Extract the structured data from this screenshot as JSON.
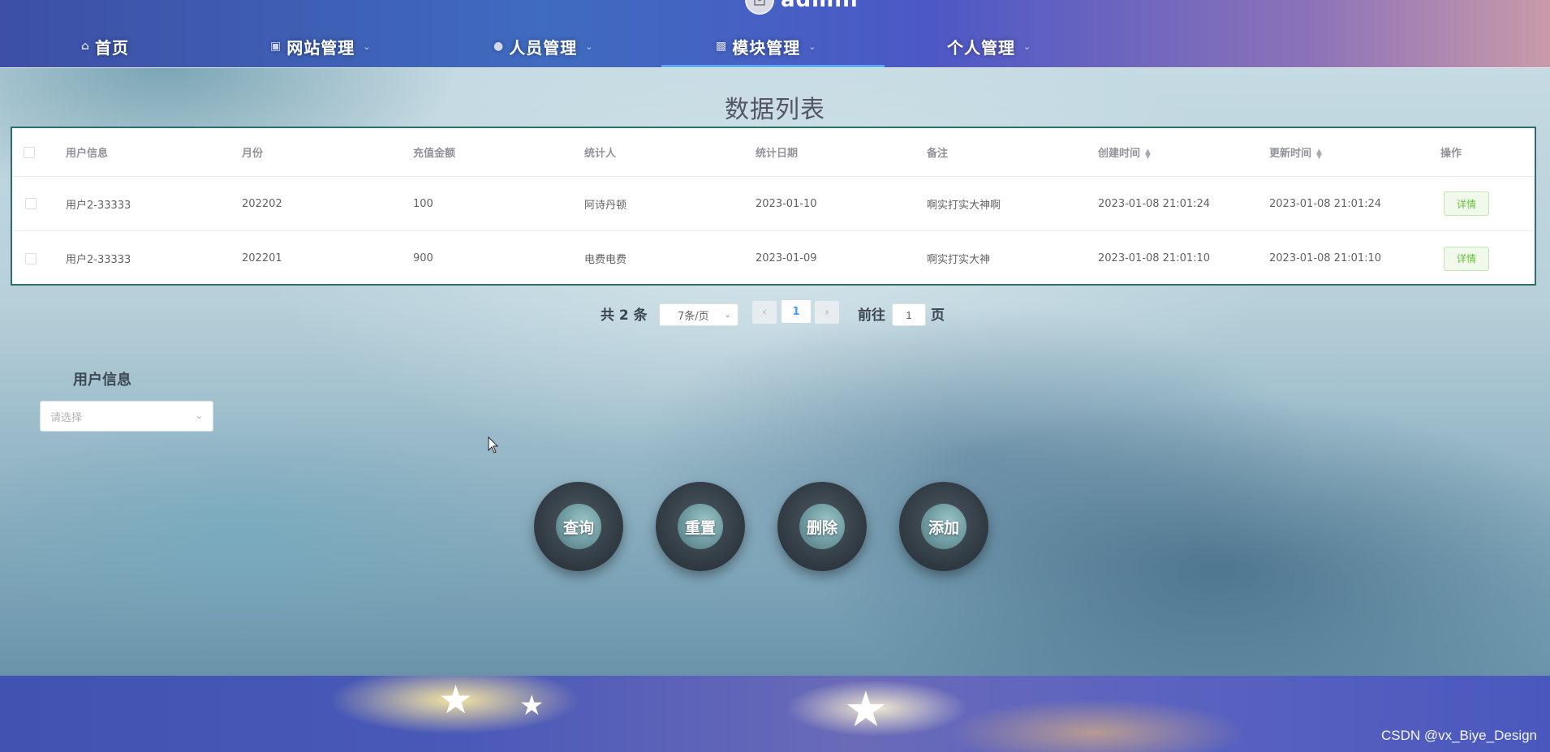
{
  "nav": {
    "admin_name": "admin",
    "items": [
      {
        "label": "首页"
      },
      {
        "label": "网站管理"
      },
      {
        "label": "人员管理"
      },
      {
        "label": "模块管理"
      },
      {
        "label": "个人管理"
      }
    ],
    "active_index": 3
  },
  "page_title": "数据列表",
  "table": {
    "columns": [
      "用户信息",
      "月份",
      "充值金额",
      "统计人",
      "统计日期",
      "备注",
      "创建时间",
      "更新时间",
      "操作"
    ],
    "rows": [
      {
        "user": "用户2-33333",
        "month": "202202",
        "amount": "100",
        "stat_person": "阿诗丹顿",
        "stat_date": "2023-01-10",
        "note": "啊实打实大神啊",
        "created": "2023-01-08 21:01:24",
        "updated": "2023-01-08 21:01:24",
        "action": "详情"
      },
      {
        "user": "用户2-33333",
        "month": "202201",
        "amount": "900",
        "stat_person": "电费电费",
        "stat_date": "2023-01-09",
        "note": "啊实打实大神",
        "created": "2023-01-08 21:01:10",
        "updated": "2023-01-08 21:01:10",
        "action": "详情"
      }
    ]
  },
  "pagination": {
    "total_label": "共 2 条",
    "page_size": "7条/页",
    "current_page": "1",
    "goto_label": "前往",
    "goto_value": "1",
    "page_suffix": "页"
  },
  "filter": {
    "label": "用户信息",
    "placeholder": "请选择"
  },
  "actions": {
    "query": "查询",
    "reset": "重置",
    "delete": "删除",
    "add": "添加"
  },
  "footer": {
    "watermark": "CSDN @vx_Biye_Design"
  },
  "colors": {
    "table_border": "#2f6e6a",
    "detail_text": "#67c23a",
    "active_underline": "#5aa8ff"
  }
}
